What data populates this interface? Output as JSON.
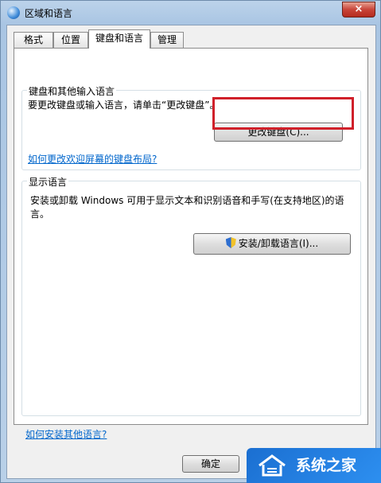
{
  "window": {
    "title": "区域和语言",
    "close_glyph": "×"
  },
  "tabs": [
    {
      "label": "格式"
    },
    {
      "label": "位置"
    },
    {
      "label": "键盘和语言"
    },
    {
      "label": "管理"
    }
  ],
  "keyboard_group": {
    "legend": "键盘和其他输入语言",
    "description": "要更改键盘或输入语言，请单击“更改键盘”。",
    "change_button": "更改键盘(C)...",
    "link": "如何更改欢迎屏幕的键盘布局?"
  },
  "display_group": {
    "legend": "显示语言",
    "description": "安装或卸载 Windows 可用于显示文本和识别语音和手写(在支持地区)的语言。",
    "install_button": "安装/卸载语言(I)..."
  },
  "footer": {
    "help_link": "如何安装其他语言?",
    "ok_button": "确定"
  },
  "watermark": {
    "text": "系统之家"
  },
  "colors": {
    "highlight": "#d0202a",
    "link": "#0066cc",
    "watermark_bg": "#1b6fd1"
  }
}
